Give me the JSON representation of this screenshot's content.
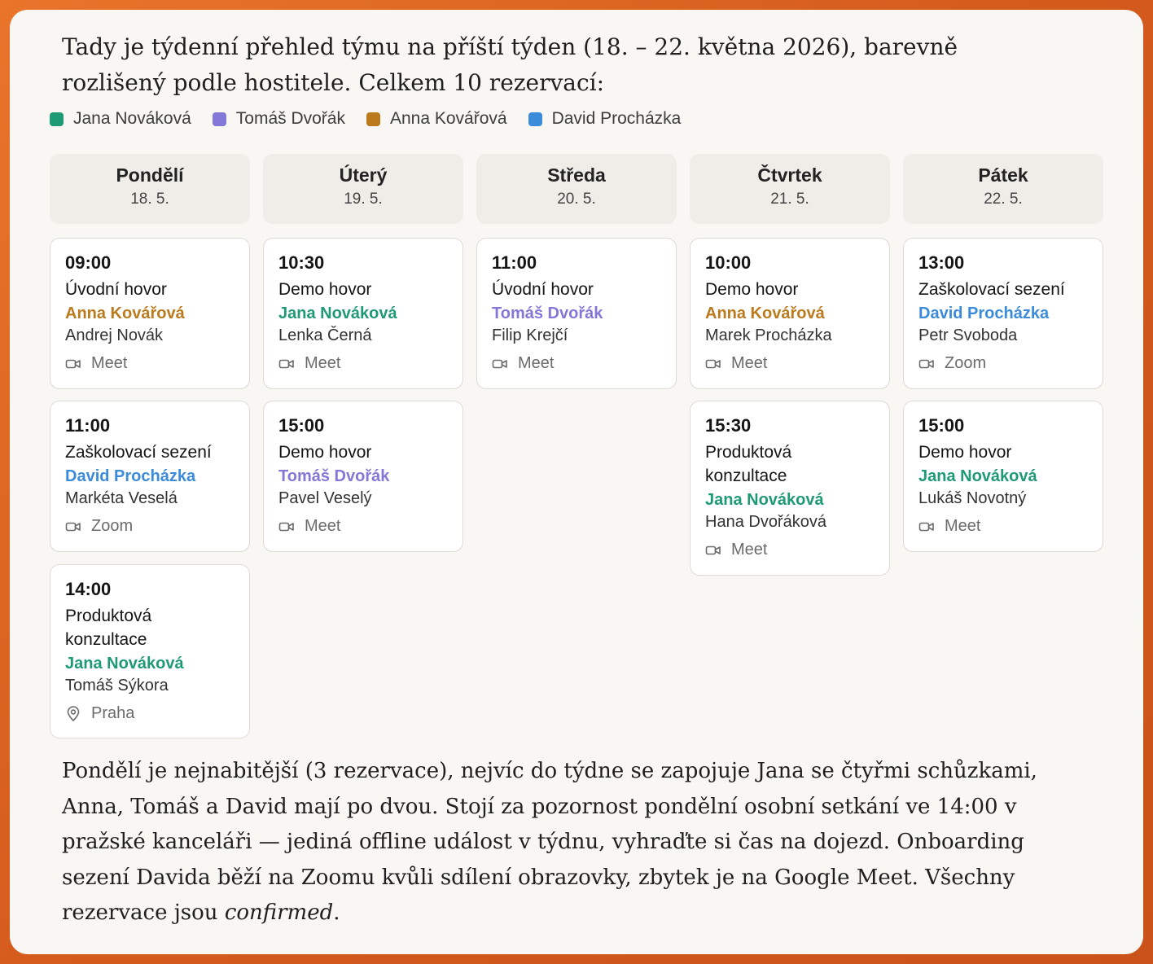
{
  "intro": "Tady je týdenní přehled týmu na příští týden (18. – 22. května 2026), barevně rozlišený podle hostitele. Celkem 10 rezervací:",
  "hosts": [
    {
      "name": "Jana Nováková",
      "color": "#1f9a75"
    },
    {
      "name": "Tomáš Dvořák",
      "color": "#8378d8"
    },
    {
      "name": "Anna Kovářová",
      "color": "#bb7a1c"
    },
    {
      "name": "David Procházka",
      "color": "#3b8bdb"
    }
  ],
  "days": [
    {
      "name": "Pondělí",
      "date": "18. 5.",
      "events": [
        {
          "time": "09:00",
          "title": "Úvodní hovor",
          "host": "Anna Kovářová",
          "host_color": "#bb7a1c",
          "guest": "Andrej Novák",
          "location": "Meet",
          "location_icon": "video-camera-icon"
        },
        {
          "time": "11:00",
          "title": "Zaškolovací sezení",
          "host": "David Procházka",
          "host_color": "#3b8bdb",
          "guest": "Markéta Veselá",
          "location": "Zoom",
          "location_icon": "video-camera-icon"
        },
        {
          "time": "14:00",
          "title": "Produktová konzultace",
          "host": "Jana Nováková",
          "host_color": "#1f9a75",
          "guest": "Tomáš Sýkora",
          "location": "Praha",
          "location_icon": "map-pin-icon"
        }
      ]
    },
    {
      "name": "Úterý",
      "date": "19. 5.",
      "events": [
        {
          "time": "10:30",
          "title": "Demo hovor",
          "host": "Jana Nováková",
          "host_color": "#1f9a75",
          "guest": "Lenka Černá",
          "location": "Meet",
          "location_icon": "video-camera-icon"
        },
        {
          "time": "15:00",
          "title": "Demo hovor",
          "host": "Tomáš Dvořák",
          "host_color": "#8378d8",
          "guest": "Pavel Veselý",
          "location": "Meet",
          "location_icon": "video-camera-icon"
        }
      ]
    },
    {
      "name": "Středa",
      "date": "20. 5.",
      "events": [
        {
          "time": "11:00",
          "title": "Úvodní hovor",
          "host": "Tomáš Dvořák",
          "host_color": "#8378d8",
          "guest": "Filip Krejčí",
          "location": "Meet",
          "location_icon": "video-camera-icon"
        }
      ]
    },
    {
      "name": "Čtvrtek",
      "date": "21. 5.",
      "events": [
        {
          "time": "10:00",
          "title": "Demo hovor",
          "host": "Anna Kovářová",
          "host_color": "#bb7a1c",
          "guest": "Marek Procházka",
          "location": "Meet",
          "location_icon": "video-camera-icon"
        },
        {
          "time": "15:30",
          "title": "Produktová konzultace",
          "host": "Jana Nováková",
          "host_color": "#1f9a75",
          "guest": "Hana Dvořáková",
          "location": "Meet",
          "location_icon": "video-camera-icon"
        }
      ]
    },
    {
      "name": "Pátek",
      "date": "22. 5.",
      "events": [
        {
          "time": "13:00",
          "title": "Zaškolovací sezení",
          "host": "David Procházka",
          "host_color": "#3b8bdb",
          "guest": "Petr Svoboda",
          "location": "Zoom",
          "location_icon": "video-camera-icon"
        },
        {
          "time": "15:00",
          "title": "Demo hovor",
          "host": "Jana Nováková",
          "host_color": "#1f9a75",
          "guest": "Lukáš Novotný",
          "location": "Meet",
          "location_icon": "video-camera-icon"
        }
      ]
    }
  ],
  "outro": {
    "text": "Pondělí je nejnabitější (3 rezervace), nejvíc do týdne se zapojuje Jana se čtyřmi schůzkami, Anna, Tomáš a David mají po dvou. Stojí za pozornost pondělní osobní setkání ve 14:00 v pražské kanceláři — jediná offline událost v týdnu, vyhraďte si čas na dojezd. Onboarding sezení Davida běží na Zoomu kvůli sdílení obrazovky, zbytek je na Google Meet. Všechny rezervace jsou ",
    "emphasis": "confirmed",
    "end": "."
  }
}
